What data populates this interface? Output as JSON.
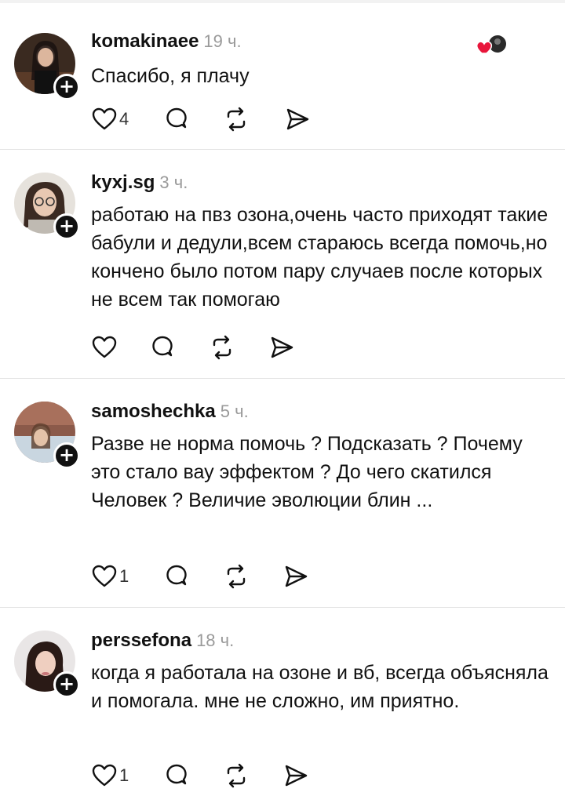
{
  "comments": [
    {
      "username": "komakinaee",
      "time": "19 ч.",
      "text": "Спасибо, я плачу",
      "likes": "4",
      "creator_liked": true
    },
    {
      "username": "kyxj.sg",
      "time": "3 ч.",
      "text": "работаю на пвз озона,очень часто приходят такие бабули и дедули,всем стараюсь всегда помочь,но кончено было потом пару случаев после которых не всем так помогаю",
      "likes": "",
      "creator_liked": false
    },
    {
      "username": "samoshechka",
      "time": "5 ч.",
      "text": "Разве не норма помочь ? Подсказать ? Почему это стало вау эффектом ? До чего скатился Человек ? Величие эволюции блин ...",
      "likes": "1",
      "creator_liked": false
    },
    {
      "username": "perssefona",
      "time": "18 ч.",
      "text": "когда я работала на озоне и вб, всегда объясняла и помогала. мне не сложно, им приятно.",
      "likes": "1",
      "creator_liked": false
    }
  ],
  "icons": {
    "like": "heart-outline-icon",
    "reply": "chat-bubble-icon",
    "repost": "repost-arrows-icon",
    "share": "send-arrow-icon",
    "follow": "plus-icon"
  },
  "colors": {
    "liked_heart": "#e8163b",
    "time": "#9a9a9a"
  }
}
